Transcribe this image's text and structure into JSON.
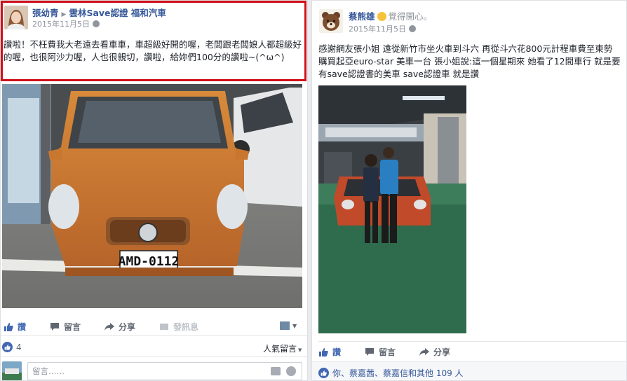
{
  "left_post": {
    "author": "張幼青",
    "target_page": "雲林Save認證 福和汽車",
    "date": "2015年11月5日",
    "text": "讚啦！不枉費我大老遠去看車車，車超級好開的喔，老闆跟老闆娘人都超級好的喔，也很阿沙力喔，人也很親切，讚啦，給妳們100分的讚啦~(^ω^)",
    "license_plate": "AMD-0112",
    "actions": {
      "like": "讚",
      "comment": "留言",
      "share": "分享",
      "message": "發訊息"
    },
    "reaction_count": "4",
    "sort_label": "人氣留言",
    "comment_placeholder": "留言……"
  },
  "right_post": {
    "author": "蔡熊雄",
    "feeling": "覺得開心。",
    "date": "2015年11月5日",
    "text": "感謝網友張小姐 遠從新竹市坐火車到斗六 再從斗六花800元計程車費至東勢 購買起亞euro-star 美車一台 張小姐說:這一個星期來 她看了12間車行 就是要有save認證書的美車 save認證車 就是讚",
    "actions": {
      "like": "讚",
      "comment": "留言",
      "share": "分享"
    },
    "likers": "你、蔡嘉茜、蔡嘉信和其他 109 人"
  },
  "colors": {
    "link": "#365899",
    "like_blue": "#4267b2",
    "highlight": "#d0101a",
    "car_orange": "#c8782a"
  }
}
